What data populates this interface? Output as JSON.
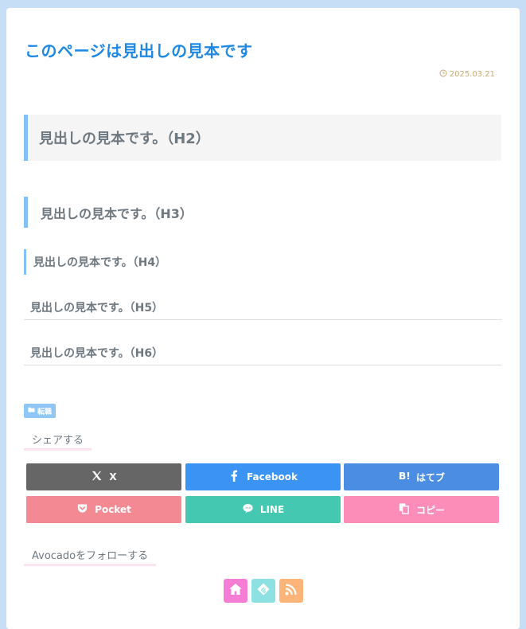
{
  "article": {
    "title": "このページは見出しの見本です",
    "date": "2025.03.21",
    "h2": "見出しの見本です。（H2）",
    "h3": "見出しの見本です。（H3）",
    "h4": "見出しの見本です。（H4）",
    "h5": "見出しの見本です。（H5）",
    "h6": "見出しの見本です。（H6）",
    "category": "転職"
  },
  "share": {
    "label": "シェアする",
    "buttons": [
      {
        "label": "X",
        "icon": "x-icon",
        "color": "#666666"
      },
      {
        "label": "Facebook",
        "icon": "facebook-icon",
        "color": "#3b94f3"
      },
      {
        "label": "はてブ",
        "icon": "hatena-bookmark-icon",
        "color": "#4b8de2"
      },
      {
        "label": "Pocket",
        "icon": "pocket-icon",
        "color": "#f38993"
      },
      {
        "label": "LINE",
        "icon": "line-icon",
        "color": "#44c8b2"
      },
      {
        "label": "コピー",
        "icon": "copy-icon",
        "color": "#fb8db8"
      }
    ]
  },
  "follow": {
    "label": "Avocadoをフォローする",
    "icons": [
      {
        "icon": "home-icon",
        "color": "#f57ed4"
      },
      {
        "icon": "feedly-icon",
        "color": "#8ee1e3"
      },
      {
        "icon": "rss-icon",
        "color": "#fdb478"
      }
    ]
  }
}
